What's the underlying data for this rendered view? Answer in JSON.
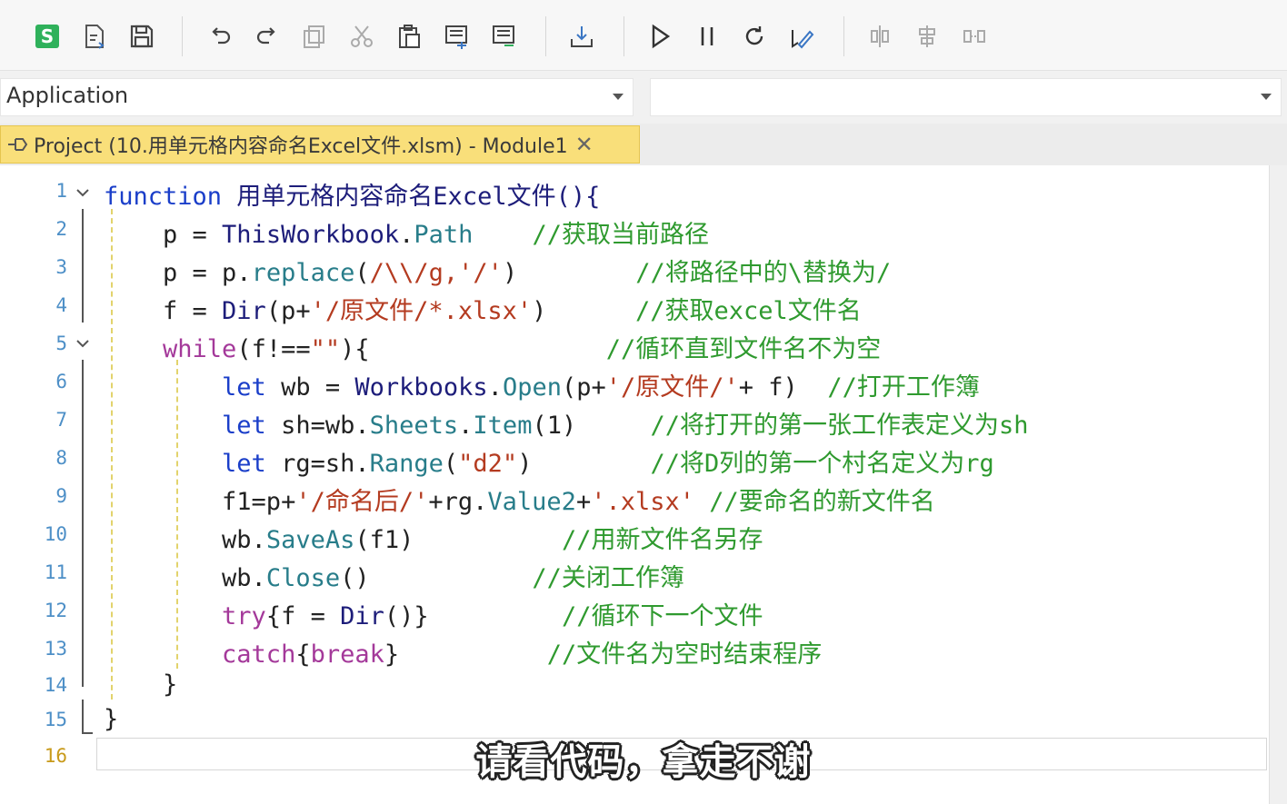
{
  "toolbar": {
    "buttons": [
      "s-logo-icon",
      "export-icon",
      "save-icon",
      "undo-icon",
      "redo-icon",
      "copy-icon",
      "cut-icon",
      "paste-icon",
      "indent-icon",
      "outdent-icon",
      "insert-module-icon",
      "run-icon",
      "pause-icon",
      "reset-icon",
      "design-mode-icon",
      "align-icon",
      "align-center-icon",
      "distribute-icon"
    ]
  },
  "selectors": {
    "left": "Application",
    "right": ""
  },
  "tab": {
    "label": "Project (10.用单元格内容命名Excel文件.xlsm) - Module1",
    "close": "✕"
  },
  "lines": {
    "n1": "1",
    "n2": "2",
    "n3": "3",
    "n4": "4",
    "n5": "5",
    "n6": "6",
    "n7": "7",
    "n8": "8",
    "n9": "9",
    "n10": "10",
    "n11": "11",
    "n12": "12",
    "n13": "13",
    "n14": "14",
    "n15": "15",
    "n16": "16"
  },
  "code": {
    "l1_kw": "function",
    "l1_rest": " 用单元格内容命名Excel文件(){",
    "l2_a": "    p = ",
    "l2_obj": "ThisWorkbook",
    "l2_dot": ".",
    "l2_prop": "Path",
    "l2_cmt": "    //获取当前路径",
    "l3_a": "    p = p.",
    "l3_prop": "replace",
    "l3_b": "(",
    "l3_str": "/\\\\/g,'/'",
    "l3_c": ")",
    "l3_cmt": "        //将路径中的\\替换为/",
    "l4_a": "    f = ",
    "l4_obj": "Dir",
    "l4_b": "(p+",
    "l4_str": "'/原文件/*.xlsx'",
    "l4_c": ")",
    "l4_cmt": "      //获取excel文件名",
    "l5_kw": "    while",
    "l5_b": "(f!==",
    "l5_str": "\"\"",
    "l5_c": "){",
    "l5_cmt": "                //循环直到文件名不为空",
    "l6_kw": "        let",
    "l6_a": " wb = ",
    "l6_obj": "Workbooks",
    "l6_dot": ".",
    "l6_prop": "Open",
    "l6_b": "(p+",
    "l6_str": "'/原文件/'",
    "l6_c": "+ f)",
    "l6_cmt": "  //打开工作簿",
    "l7_kw": "        let",
    "l7_a": " sh=wb.",
    "l7_prop": "Sheets",
    "l7_dot": ".",
    "l7_prop2": "Item",
    "l7_b": "(1)",
    "l7_cmt": "     //将打开的第一张工作表定义为sh",
    "l8_kw": "        let",
    "l8_a": " rg=sh.",
    "l8_prop": "Range",
    "l8_b": "(",
    "l8_str": "\"d2\"",
    "l8_c": ")",
    "l8_cmt": "        //将D列的第一个村名定义为rg",
    "l9_a": "        f1=p+",
    "l9_str": "'/命名后/'",
    "l9_b": "+rg.",
    "l9_prop": "Value2",
    "l9_c": "+",
    "l9_str2": "'.xlsx'",
    "l9_cmt": " //要命名的新文件名",
    "l10_a": "        wb.",
    "l10_prop": "SaveAs",
    "l10_b": "(f1)",
    "l10_cmt": "          //用新文件名另存",
    "l11_a": "        wb.",
    "l11_prop": "Close",
    "l11_b": "()",
    "l11_cmt": "           //关闭工作簿",
    "l12_kw": "        try",
    "l12_a": "{f = ",
    "l12_obj": "Dir",
    "l12_b": "()}",
    "l12_cmt": "         //循环下一个文件",
    "l13_kw": "        catch",
    "l13_a": "{",
    "l13_kw2": "break",
    "l13_b": "}",
    "l13_cmt": "          //文件名为空时结束程序",
    "l14": "    }",
    "l15": "}"
  },
  "subtitle": "请看代码，拿走不谢"
}
